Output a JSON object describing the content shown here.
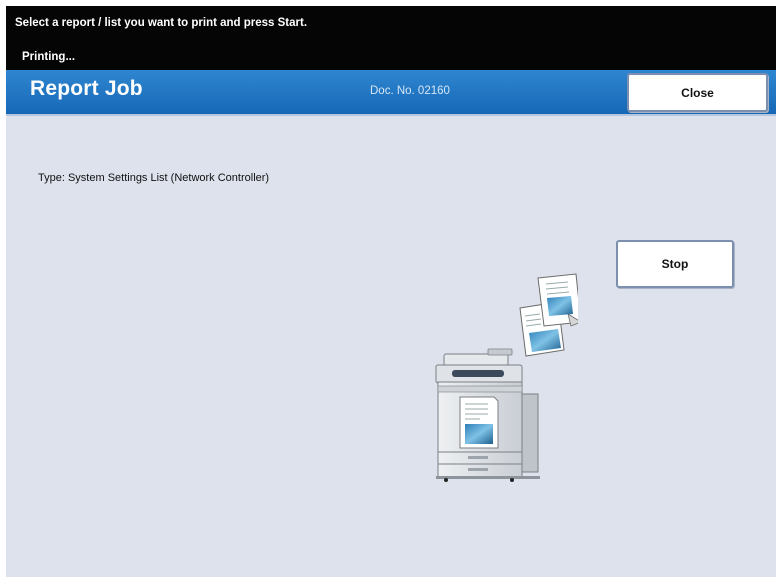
{
  "message_bar": {
    "instruction": "Select a report / list you want to print and press Start.",
    "status": "Printing..."
  },
  "header": {
    "title": "Report Job",
    "doc_no": "Doc. No. 02160",
    "close_label": "Close"
  },
  "main": {
    "type_text": "Type: System Settings List (Network Controller)",
    "stop_label": "Stop",
    "illustration_icon": "printer-printing-icon"
  },
  "colors": {
    "message_bar_bg": "#050505",
    "title_bar_blue": "#1f78c5",
    "panel_bg": "#dde2ec"
  }
}
